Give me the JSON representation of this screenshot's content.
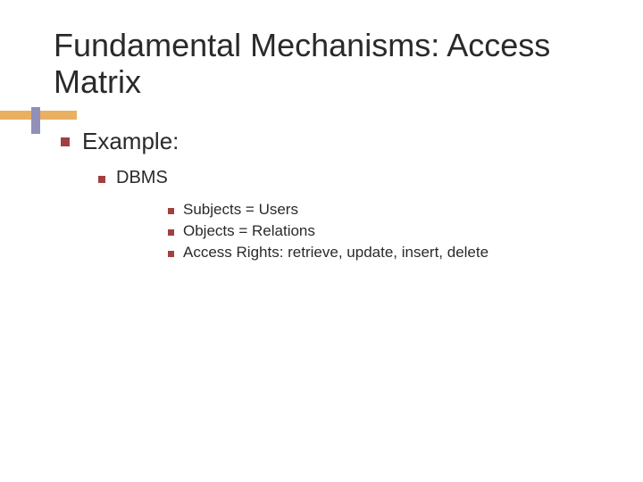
{
  "title": "Fundamental Mechanisms: Access Matrix",
  "bullets": {
    "l1": "Example:",
    "l2": "DBMS",
    "l3_1": "Subjects = Users",
    "l3_2": "Objects = Relations",
    "l3_3": "Access Rights: retrieve, update, insert, delete"
  }
}
